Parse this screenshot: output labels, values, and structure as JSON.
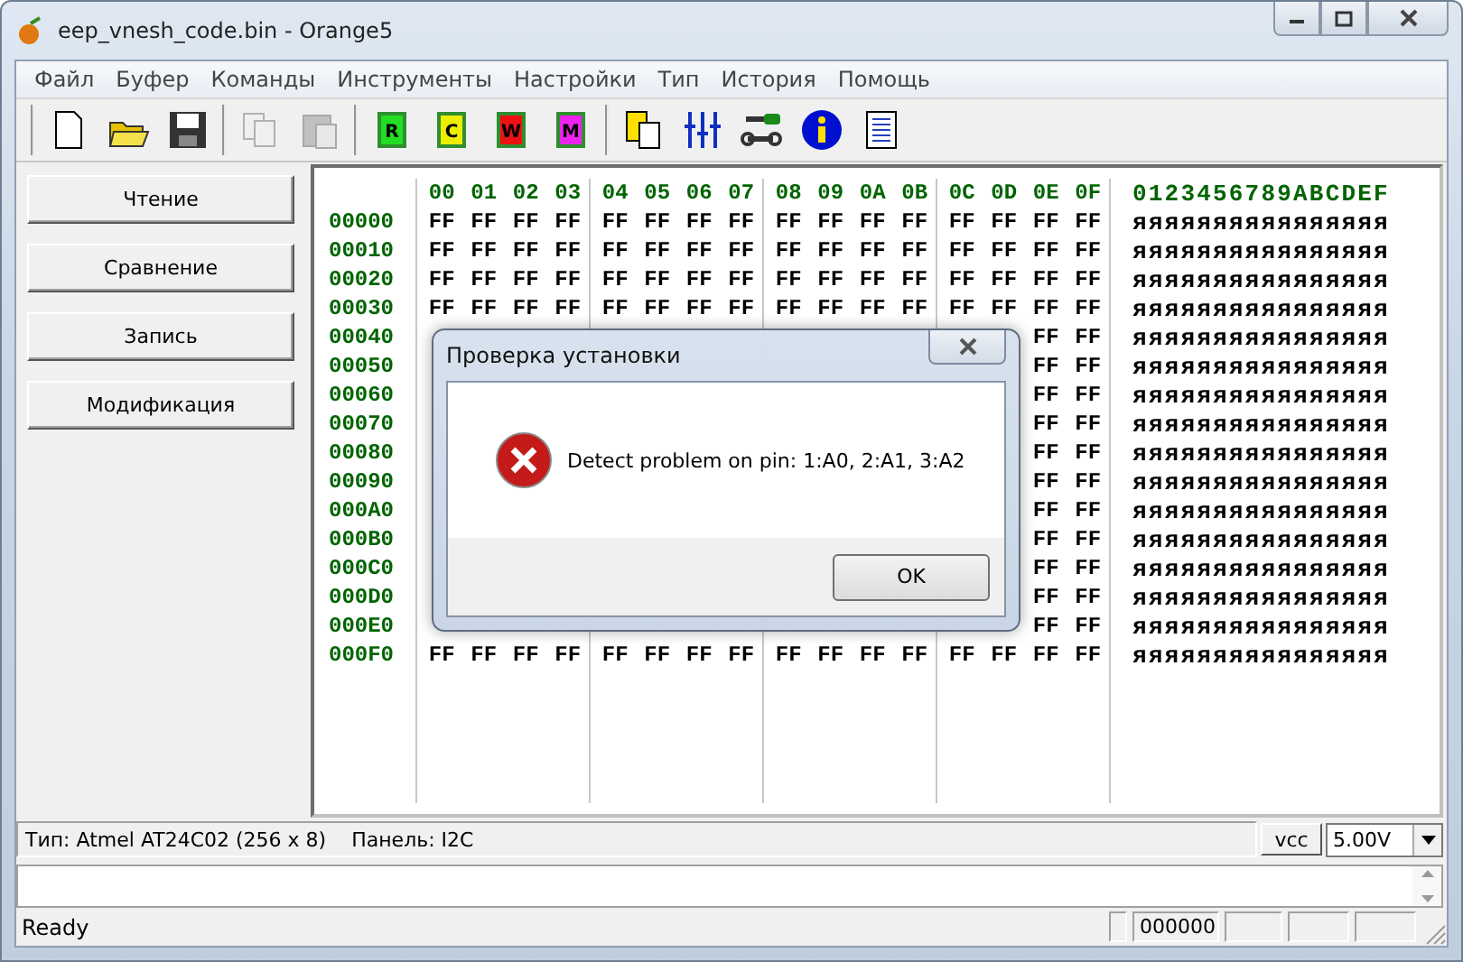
{
  "window": {
    "title": "eep_vnesh_code.bin - Orange5"
  },
  "menu": [
    "Файл",
    "Буфер",
    "Команды",
    "Инструменты",
    "Настройки",
    "Тип",
    "История",
    "Помощь"
  ],
  "toolbar": {
    "groups": [
      {
        "items": [
          {
            "kind": "new",
            "disabled": false
          },
          {
            "kind": "open",
            "disabled": false
          },
          {
            "kind": "save",
            "disabled": false
          }
        ]
      },
      {
        "items": [
          {
            "kind": "copy",
            "disabled": true
          },
          {
            "kind": "paste",
            "disabled": true
          }
        ]
      },
      {
        "items": [
          {
            "kind": "chip",
            "label": "R",
            "color": "#22dd22"
          },
          {
            "kind": "chip",
            "label": "C",
            "color": "#eeee00"
          },
          {
            "kind": "chip",
            "label": "W",
            "color": "#ee1111"
          },
          {
            "kind": "chip",
            "label": "M",
            "color": "#ee22ee"
          }
        ]
      },
      {
        "items": [
          {
            "kind": "device",
            "disabled": false
          },
          {
            "kind": "sliders",
            "disabled": false
          },
          {
            "kind": "tools",
            "disabled": false
          },
          {
            "kind": "info",
            "disabled": false
          },
          {
            "kind": "document",
            "disabled": false
          }
        ]
      }
    ]
  },
  "side_buttons": [
    "Чтение",
    "Сравнение",
    "Запись",
    "Модификация"
  ],
  "hex": {
    "columns": [
      "00",
      "01",
      "02",
      "03",
      "04",
      "05",
      "06",
      "07",
      "08",
      "09",
      "0A",
      "0B",
      "0C",
      "0D",
      "0E",
      "0F"
    ],
    "ascii_header": "0123456789ABCDEF",
    "rows": [
      {
        "address": "00000",
        "bytes": [
          "FF",
          "FF",
          "FF",
          "FF",
          "FF",
          "FF",
          "FF",
          "FF",
          "FF",
          "FF",
          "FF",
          "FF",
          "FF",
          "FF",
          "FF",
          "FF"
        ],
        "ascii": "яяяяяяяяяяяяяяяя"
      },
      {
        "address": "00010",
        "bytes": [
          "FF",
          "FF",
          "FF",
          "FF",
          "FF",
          "FF",
          "FF",
          "FF",
          "FF",
          "FF",
          "FF",
          "FF",
          "FF",
          "FF",
          "FF",
          "FF"
        ],
        "ascii": "яяяяяяяяяяяяяяяя"
      },
      {
        "address": "00020",
        "bytes": [
          "FF",
          "FF",
          "FF",
          "FF",
          "FF",
          "FF",
          "FF",
          "FF",
          "FF",
          "FF",
          "FF",
          "FF",
          "FF",
          "FF",
          "FF",
          "FF"
        ],
        "ascii": "яяяяяяяяяяяяяяяя"
      },
      {
        "address": "00030",
        "bytes": [
          "FF",
          "FF",
          "FF",
          "FF",
          "FF",
          "FF",
          "FF",
          "FF",
          "FF",
          "FF",
          "FF",
          "FF",
          "FF",
          "FF",
          "FF",
          "FF"
        ],
        "ascii": "яяяяяяяяяяяяяяяя"
      },
      {
        "address": "00040",
        "bytes": [
          "FF",
          "FF"
        ],
        "ascii": "яяяяяяяяяяяяяяяя"
      },
      {
        "address": "00050",
        "bytes": [
          "FF",
          "FF"
        ],
        "ascii": "яяяяяяяяяяяяяяяя"
      },
      {
        "address": "00060",
        "bytes": [
          "FF",
          "FF"
        ],
        "ascii": "яяяяяяяяяяяяяяяя"
      },
      {
        "address": "00070",
        "bytes": [
          "FF",
          "FF"
        ],
        "ascii": "яяяяяяяяяяяяяяяя"
      },
      {
        "address": "00080",
        "bytes": [
          "FF",
          "FF"
        ],
        "ascii": "яяяяяяяяяяяяяяяя"
      },
      {
        "address": "00090",
        "bytes": [
          "FF",
          "FF"
        ],
        "ascii": "яяяяяяяяяяяяяяяя"
      },
      {
        "address": "000A0",
        "bytes": [
          "FF",
          "FF"
        ],
        "ascii": "яяяяяяяяяяяяяяяя"
      },
      {
        "address": "000B0",
        "bytes": [
          "FF",
          "FF"
        ],
        "ascii": "яяяяяяяяяяяяяяяя"
      },
      {
        "address": "000C0",
        "bytes": [
          "FF",
          "FF"
        ],
        "ascii": "яяяяяяяяяяяяяяяя"
      },
      {
        "address": "000D0",
        "bytes": [
          "FF",
          "FF"
        ],
        "ascii": "яяяяяяяяяяяяяяяя"
      },
      {
        "address": "000E0",
        "bytes": [
          "FF",
          "FF"
        ],
        "ascii": "яяяяяяяяяяяяяяяя"
      },
      {
        "address": "000F0",
        "bytes": [
          "FF",
          "FF",
          "FF",
          "FF",
          "FF",
          "FF",
          "FF",
          "FF",
          "FF",
          "FF",
          "FF",
          "FF",
          "FF",
          "FF",
          "FF",
          "FF"
        ],
        "ascii": "яяяяяяяяяяяяяяяя"
      }
    ]
  },
  "dialog": {
    "title": "Проверка установки",
    "message": "Detect problem on pin: 1:A0, 2:A1, 3:A2",
    "button": "OK"
  },
  "info_bar": {
    "type": "Тип: Atmel AT24C02 (256 x 8)",
    "panel": "Панель: I2C",
    "vcc_button": "vcc",
    "voltage": "5.00V"
  },
  "status_bar": {
    "text": "Ready",
    "panels": [
      "000000"
    ]
  }
}
